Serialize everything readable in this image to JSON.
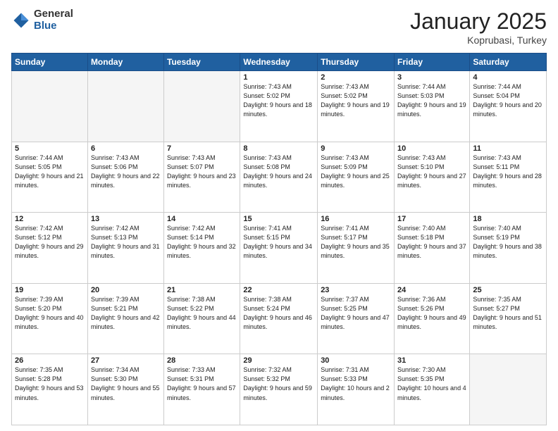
{
  "header": {
    "logo_general": "General",
    "logo_blue": "Blue",
    "month": "January 2025",
    "location": "Koprubasi, Turkey"
  },
  "weekdays": [
    "Sunday",
    "Monday",
    "Tuesday",
    "Wednesday",
    "Thursday",
    "Friday",
    "Saturday"
  ],
  "weeks": [
    [
      {
        "day": "",
        "empty": true
      },
      {
        "day": "",
        "empty": true
      },
      {
        "day": "",
        "empty": true
      },
      {
        "day": "1",
        "sunrise": "7:43 AM",
        "sunset": "5:02 PM",
        "daylight": "9 hours and 18 minutes."
      },
      {
        "day": "2",
        "sunrise": "7:43 AM",
        "sunset": "5:02 PM",
        "daylight": "9 hours and 19 minutes."
      },
      {
        "day": "3",
        "sunrise": "7:44 AM",
        "sunset": "5:03 PM",
        "daylight": "9 hours and 19 minutes."
      },
      {
        "day": "4",
        "sunrise": "7:44 AM",
        "sunset": "5:04 PM",
        "daylight": "9 hours and 20 minutes."
      }
    ],
    [
      {
        "day": "5",
        "sunrise": "7:44 AM",
        "sunset": "5:05 PM",
        "daylight": "9 hours and 21 minutes."
      },
      {
        "day": "6",
        "sunrise": "7:43 AM",
        "sunset": "5:06 PM",
        "daylight": "9 hours and 22 minutes."
      },
      {
        "day": "7",
        "sunrise": "7:43 AM",
        "sunset": "5:07 PM",
        "daylight": "9 hours and 23 minutes."
      },
      {
        "day": "8",
        "sunrise": "7:43 AM",
        "sunset": "5:08 PM",
        "daylight": "9 hours and 24 minutes."
      },
      {
        "day": "9",
        "sunrise": "7:43 AM",
        "sunset": "5:09 PM",
        "daylight": "9 hours and 25 minutes."
      },
      {
        "day": "10",
        "sunrise": "7:43 AM",
        "sunset": "5:10 PM",
        "daylight": "9 hours and 27 minutes."
      },
      {
        "day": "11",
        "sunrise": "7:43 AM",
        "sunset": "5:11 PM",
        "daylight": "9 hours and 28 minutes."
      }
    ],
    [
      {
        "day": "12",
        "sunrise": "7:42 AM",
        "sunset": "5:12 PM",
        "daylight": "9 hours and 29 minutes."
      },
      {
        "day": "13",
        "sunrise": "7:42 AM",
        "sunset": "5:13 PM",
        "daylight": "9 hours and 31 minutes."
      },
      {
        "day": "14",
        "sunrise": "7:42 AM",
        "sunset": "5:14 PM",
        "daylight": "9 hours and 32 minutes."
      },
      {
        "day": "15",
        "sunrise": "7:41 AM",
        "sunset": "5:15 PM",
        "daylight": "9 hours and 34 minutes."
      },
      {
        "day": "16",
        "sunrise": "7:41 AM",
        "sunset": "5:17 PM",
        "daylight": "9 hours and 35 minutes."
      },
      {
        "day": "17",
        "sunrise": "7:40 AM",
        "sunset": "5:18 PM",
        "daylight": "9 hours and 37 minutes."
      },
      {
        "day": "18",
        "sunrise": "7:40 AM",
        "sunset": "5:19 PM",
        "daylight": "9 hours and 38 minutes."
      }
    ],
    [
      {
        "day": "19",
        "sunrise": "7:39 AM",
        "sunset": "5:20 PM",
        "daylight": "9 hours and 40 minutes."
      },
      {
        "day": "20",
        "sunrise": "7:39 AM",
        "sunset": "5:21 PM",
        "daylight": "9 hours and 42 minutes."
      },
      {
        "day": "21",
        "sunrise": "7:38 AM",
        "sunset": "5:22 PM",
        "daylight": "9 hours and 44 minutes."
      },
      {
        "day": "22",
        "sunrise": "7:38 AM",
        "sunset": "5:24 PM",
        "daylight": "9 hours and 46 minutes."
      },
      {
        "day": "23",
        "sunrise": "7:37 AM",
        "sunset": "5:25 PM",
        "daylight": "9 hours and 47 minutes."
      },
      {
        "day": "24",
        "sunrise": "7:36 AM",
        "sunset": "5:26 PM",
        "daylight": "9 hours and 49 minutes."
      },
      {
        "day": "25",
        "sunrise": "7:35 AM",
        "sunset": "5:27 PM",
        "daylight": "9 hours and 51 minutes."
      }
    ],
    [
      {
        "day": "26",
        "sunrise": "7:35 AM",
        "sunset": "5:28 PM",
        "daylight": "9 hours and 53 minutes."
      },
      {
        "day": "27",
        "sunrise": "7:34 AM",
        "sunset": "5:30 PM",
        "daylight": "9 hours and 55 minutes."
      },
      {
        "day": "28",
        "sunrise": "7:33 AM",
        "sunset": "5:31 PM",
        "daylight": "9 hours and 57 minutes."
      },
      {
        "day": "29",
        "sunrise": "7:32 AM",
        "sunset": "5:32 PM",
        "daylight": "9 hours and 59 minutes."
      },
      {
        "day": "30",
        "sunrise": "7:31 AM",
        "sunset": "5:33 PM",
        "daylight": "10 hours and 2 minutes."
      },
      {
        "day": "31",
        "sunrise": "7:30 AM",
        "sunset": "5:35 PM",
        "daylight": "10 hours and 4 minutes."
      },
      {
        "day": "",
        "empty": true
      }
    ]
  ]
}
